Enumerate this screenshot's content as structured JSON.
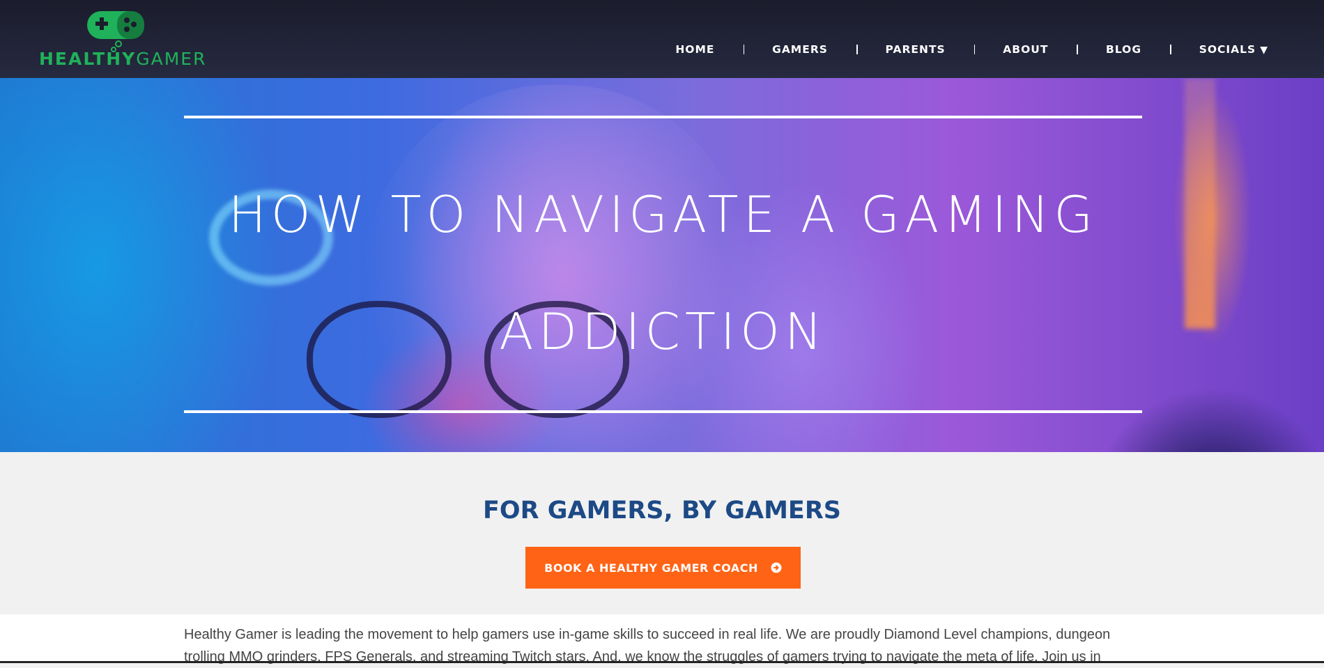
{
  "brand": {
    "name_bold": "HEALTHY",
    "name_light": "GAMER",
    "logo_color": "#1fb25a"
  },
  "nav": {
    "items": [
      {
        "label": "HOME"
      },
      {
        "label": "GAMERS"
      },
      {
        "label": "PARENTS"
      },
      {
        "label": "ABOUT"
      },
      {
        "label": "BLOG"
      },
      {
        "label": "SOCIALS",
        "caret": "▼"
      }
    ]
  },
  "hero": {
    "title_line1": "HOW TO NAVIGATE A GAMING",
    "title_line2": "ADDICTION"
  },
  "tagline": {
    "text": "FOR GAMERS, BY GAMERS",
    "color": "#1d4a86"
  },
  "cta": {
    "label": "BOOK A HEALTHY GAMER COACH",
    "icon": "arrow-circle-right-icon",
    "color": "#ff6315"
  },
  "intro": {
    "text": "Healthy Gamer is leading the movement to help gamers use in-game skills to succeed in real life. We are proudly Diamond Level champions, dungeon trolling MMO grinders, FPS Generals, and streaming Twitch stars. And, we know the struggles of gamers trying to navigate the meta of life. Join us in"
  }
}
